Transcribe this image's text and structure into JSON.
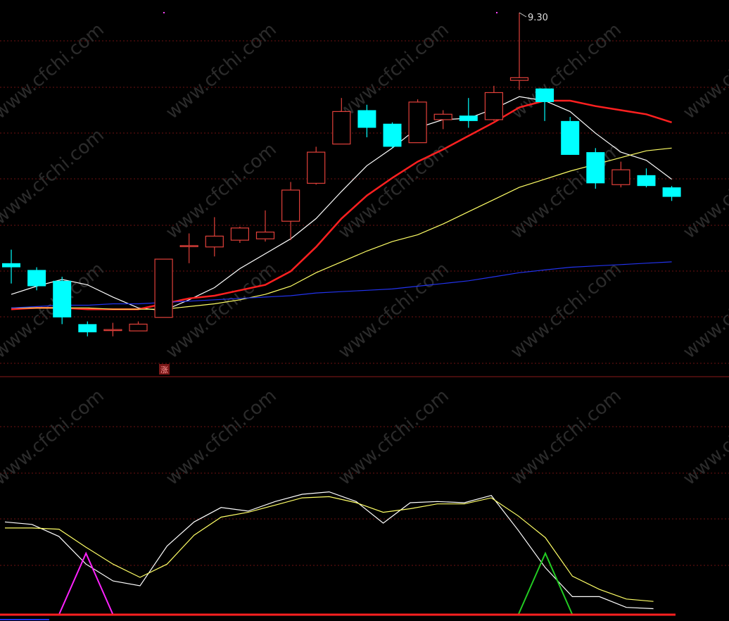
{
  "price_panel": {
    "high_label": "9.30",
    "up_marker": "涨",
    "watermark": "www.cfchi.com"
  },
  "chart_data": [
    {
      "type": "candlestick",
      "title": "",
      "xlabel": "",
      "ylabel": "",
      "ylim": [
        6.6,
        9.45
      ],
      "grid": true,
      "up_color": "#e0403a",
      "down_color": "#00ffff",
      "candles": [
        {
          "o": 7.45,
          "h": 7.55,
          "l": 7.3,
          "c": 7.42
        },
        {
          "o": 7.4,
          "h": 7.42,
          "l": 7.25,
          "c": 7.28
        },
        {
          "o": 7.32,
          "h": 7.35,
          "l": 7.0,
          "c": 7.05
        },
        {
          "o": 7.0,
          "h": 7.02,
          "l": 6.91,
          "c": 6.94
        },
        {
          "o": 6.96,
          "h": 7.01,
          "l": 6.91,
          "c": 6.96
        },
        {
          "o": 6.95,
          "h": 7.02,
          "l": 6.95,
          "c": 7.0
        },
        {
          "o": 7.05,
          "h": 7.48,
          "l": 7.05,
          "c": 7.48
        },
        {
          "o": 7.58,
          "h": 7.67,
          "l": 7.45,
          "c": 7.58
        },
        {
          "o": 7.57,
          "h": 7.79,
          "l": 7.5,
          "c": 7.65
        },
        {
          "o": 7.62,
          "h": 7.72,
          "l": 7.6,
          "c": 7.71
        },
        {
          "o": 7.63,
          "h": 7.84,
          "l": 7.61,
          "c": 7.68
        },
        {
          "o": 7.76,
          "h": 8.05,
          "l": 7.62,
          "c": 7.99
        },
        {
          "o": 8.04,
          "h": 8.31,
          "l": 8.03,
          "c": 8.27
        },
        {
          "o": 8.33,
          "h": 8.67,
          "l": 8.33,
          "c": 8.57
        },
        {
          "o": 8.58,
          "h": 8.62,
          "l": 8.38,
          "c": 8.45
        },
        {
          "o": 8.48,
          "h": 8.49,
          "l": 8.3,
          "c": 8.31
        },
        {
          "o": 8.34,
          "h": 8.66,
          "l": 8.34,
          "c": 8.64
        },
        {
          "o": 8.51,
          "h": 8.58,
          "l": 8.44,
          "c": 8.55
        },
        {
          "o": 8.54,
          "h": 8.67,
          "l": 8.45,
          "c": 8.5
        },
        {
          "o": 8.51,
          "h": 8.76,
          "l": 8.5,
          "c": 8.71
        },
        {
          "o": 8.8,
          "h": 9.3,
          "l": 8.73,
          "c": 8.82
        },
        {
          "o": 8.74,
          "h": 8.74,
          "l": 8.5,
          "c": 8.64
        },
        {
          "o": 8.5,
          "h": 8.53,
          "l": 8.25,
          "c": 8.25
        },
        {
          "o": 8.27,
          "h": 8.3,
          "l": 8.0,
          "c": 8.04
        },
        {
          "o": 8.03,
          "h": 8.2,
          "l": 8.01,
          "c": 8.14
        },
        {
          "o": 8.1,
          "h": 8.15,
          "l": 8.01,
          "c": 8.02
        },
        {
          "o": 8.01,
          "h": 8.02,
          "l": 7.91,
          "c": 7.94
        }
      ],
      "series": [
        {
          "color": "#ffffff",
          "values": [
            7.22,
            7.28,
            7.33,
            7.29,
            7.2,
            7.12,
            7.1,
            7.18,
            7.27,
            7.41,
            7.52,
            7.63,
            7.78,
            7.98,
            8.17,
            8.3,
            8.45,
            8.51,
            8.52,
            8.59,
            8.68,
            8.65,
            8.57,
            8.41,
            8.27,
            8.21,
            8.07
          ]
        },
        {
          "color": "#ff2020",
          "values": [
            7.11,
            7.12,
            7.12,
            7.11,
            7.11,
            7.11,
            7.15,
            7.19,
            7.21,
            7.25,
            7.29,
            7.39,
            7.57,
            7.78,
            7.95,
            8.08,
            8.2,
            8.29,
            8.39,
            8.49,
            8.6,
            8.65,
            8.65,
            8.61,
            8.58,
            8.55,
            8.49
          ]
        },
        {
          "color": "#ffff66",
          "values": [
            7.12,
            7.12,
            7.12,
            7.12,
            7.11,
            7.11,
            7.11,
            7.13,
            7.15,
            7.18,
            7.22,
            7.28,
            7.38,
            7.46,
            7.54,
            7.61,
            7.66,
            7.74,
            7.83,
            7.92,
            8.01,
            8.07,
            8.13,
            8.18,
            8.23,
            8.28,
            8.3
          ]
        },
        {
          "color": "#2233ee",
          "values": [
            7.12,
            7.13,
            7.14,
            7.14,
            7.15,
            7.15,
            7.16,
            7.17,
            7.18,
            7.19,
            7.2,
            7.21,
            7.23,
            7.24,
            7.25,
            7.26,
            7.28,
            7.3,
            7.32,
            7.35,
            7.38,
            7.4,
            7.42,
            7.43,
            7.44,
            7.45,
            7.46
          ]
        }
      ]
    },
    {
      "type": "line",
      "title": "",
      "xlabel": "",
      "ylabel": "",
      "ylim": [
        0,
        100
      ],
      "grid": true,
      "series": [
        {
          "color": "#ffffff",
          "values": [
            77,
            75,
            65,
            42,
            28,
            24,
            57,
            77,
            89,
            86,
            94,
            100,
            102,
            94,
            76,
            93,
            94,
            93,
            99,
            70,
            39,
            15,
            15,
            6,
            5
          ]
        },
        {
          "color": "#ffff66",
          "values": [
            72,
            72,
            71,
            56,
            42,
            31,
            42,
            66,
            81,
            85,
            91,
            97,
            98,
            93,
            85,
            88,
            92,
            92,
            97,
            82,
            64,
            32,
            21,
            13,
            11
          ]
        },
        {
          "color": "#ff22ff",
          "values": [
            0,
            0,
            0,
            51,
            0,
            0,
            0,
            0,
            0,
            0,
            0,
            0,
            0,
            0,
            0,
            0,
            0,
            0,
            0,
            0,
            0,
            0,
            0,
            0,
            0
          ]
        },
        {
          "color": "#22cc22",
          "values": [
            0,
            0,
            0,
            0,
            0,
            0,
            0,
            0,
            0,
            0,
            0,
            0,
            0,
            0,
            0,
            0,
            0,
            0,
            0,
            0,
            51,
            0,
            0,
            0,
            0
          ]
        }
      ]
    }
  ]
}
